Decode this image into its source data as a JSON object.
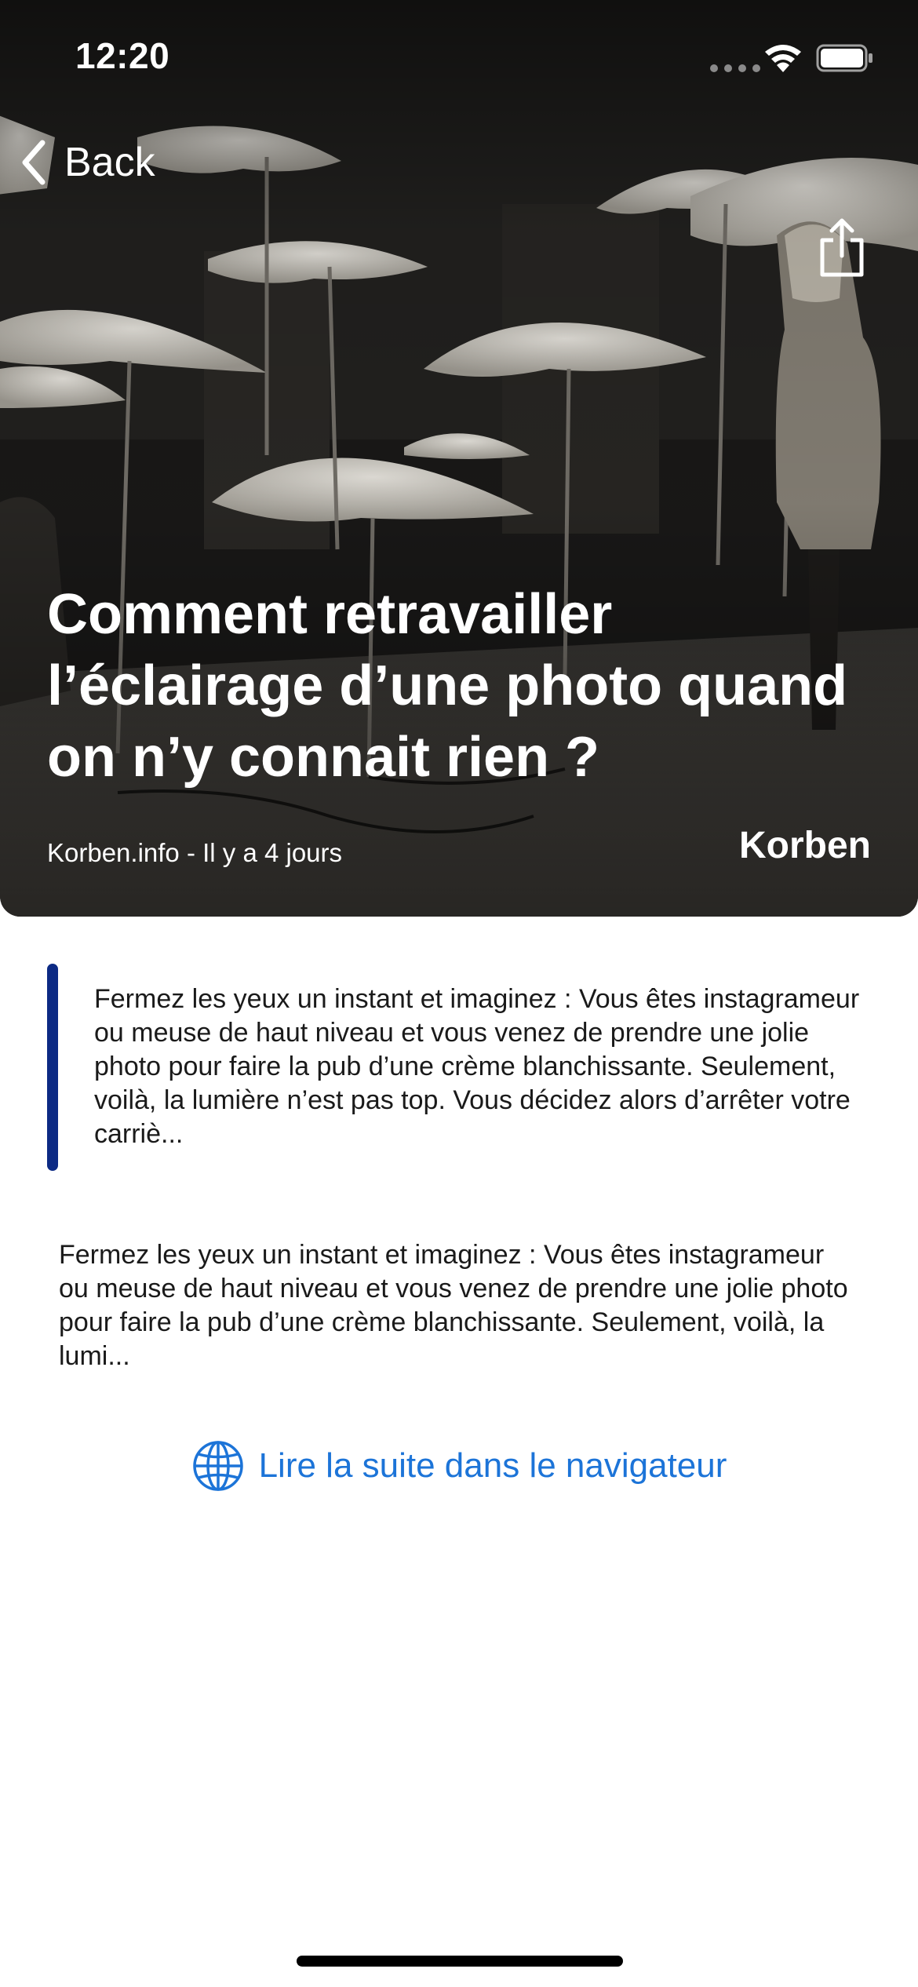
{
  "status_bar": {
    "time": "12:20"
  },
  "navigation": {
    "back_label": "Back",
    "back_icon": "chevron-left-icon",
    "share_icon": "share-icon"
  },
  "article": {
    "title": "Comment retravailler l’éclairage d’une photo quand on n’y connait rien ?",
    "meta": "Korben.info - Il y a 4 jours",
    "source": "Korben",
    "quote": "Fermez les yeux un instant et imaginez : Vous êtes instagrameur ou meuse de haut niveau et vous venez de prendre une jolie photo pour faire la pub d’une crème blanchissante. Seulement, voilà, la lumière n’est pas top. Vous décidez alors d’arrêter votre carriè...",
    "summary": "Fermez les yeux un instant et imaginez : Vous êtes instagrameur ou meuse de haut niveau et vous venez de prendre une jolie photo pour faire la pub d’une crème blanchissante. Seulement, voilà, la lumi..."
  },
  "read_more": {
    "label": "Lire la suite dans le navigateur",
    "icon": "globe-icon"
  },
  "colors": {
    "accent": "#1c74d8",
    "quote_bar": "#0c2a84"
  }
}
